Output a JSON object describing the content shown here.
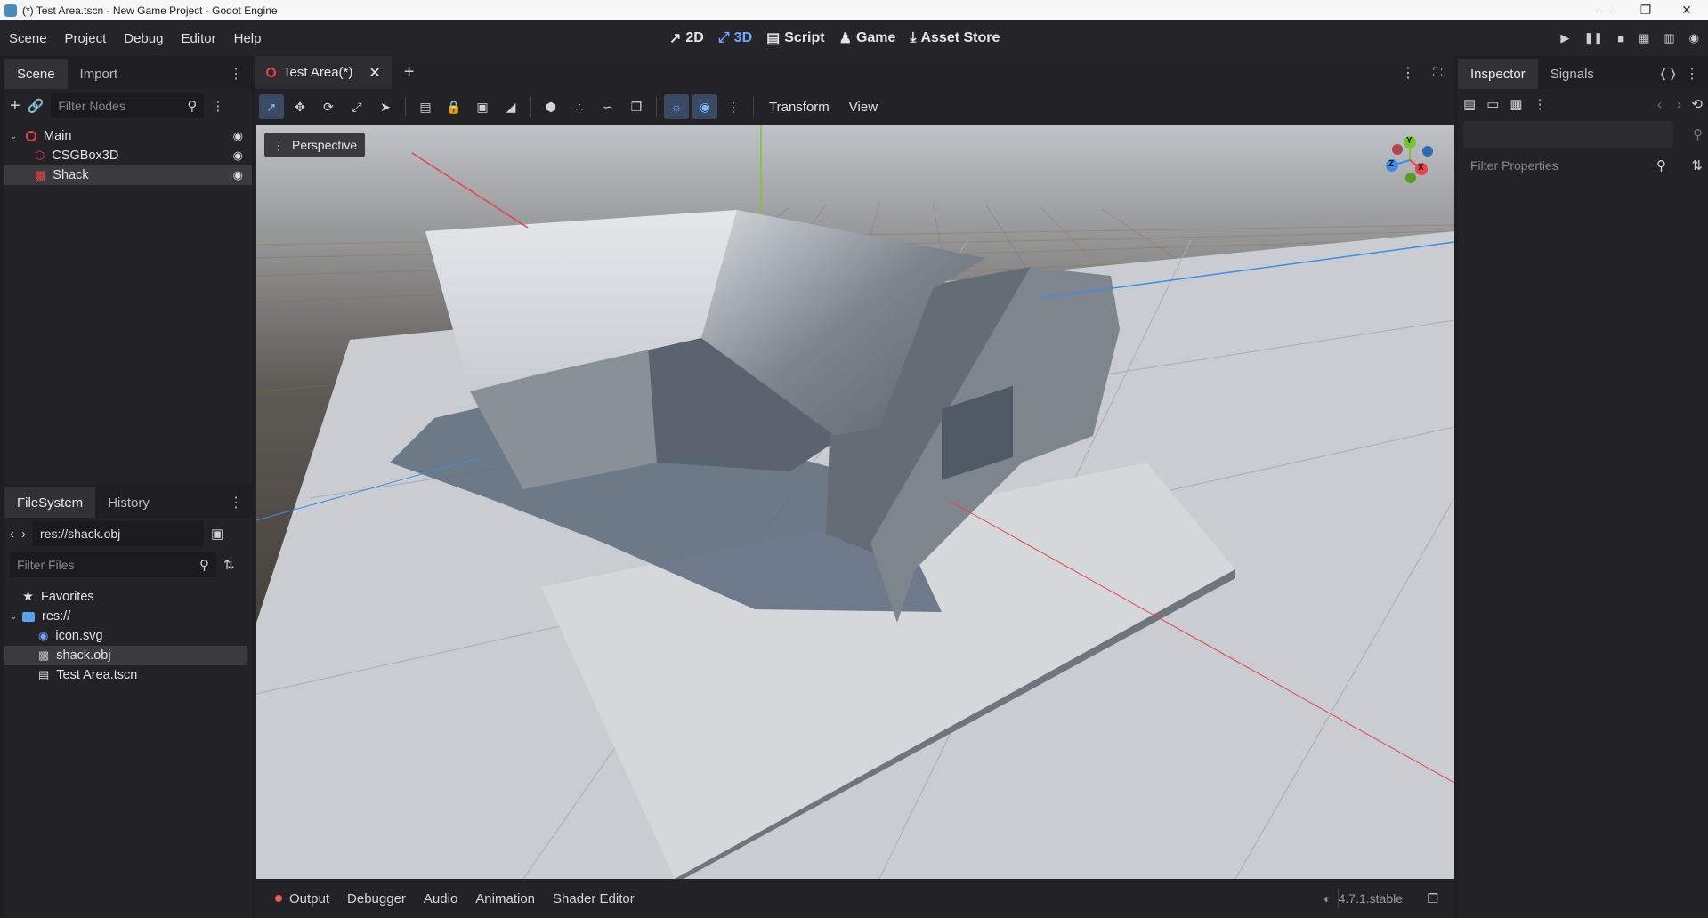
{
  "window": {
    "title": "(*) Test Area.tscn - New Game Project - Godot Engine",
    "controls": [
      "minimize",
      "restore",
      "close"
    ]
  },
  "menu": [
    "Scene",
    "Project",
    "Debug",
    "Editor",
    "Help"
  ],
  "main_tabs": [
    {
      "label": "2D",
      "icon": "2d-icon"
    },
    {
      "label": "3D",
      "icon": "3d-icon",
      "active": true
    },
    {
      "label": "Script",
      "icon": "script-icon"
    },
    {
      "label": "Game",
      "icon": "game-icon"
    },
    {
      "label": "Asset Store",
      "icon": "asset-store-icon"
    }
  ],
  "scene_panel": {
    "tabs": [
      "Scene",
      "Import"
    ],
    "filter_placeholder": "Filter Nodes",
    "nodes": [
      {
        "label": "Main",
        "icon": "node3d-icon",
        "level": 0
      },
      {
        "label": "CSGBox3D",
        "icon": "csgbox-icon",
        "level": 1
      },
      {
        "label": "Shack",
        "icon": "mesh-icon",
        "level": 1,
        "selected": true
      }
    ]
  },
  "filesystem_panel": {
    "tabs": [
      "FileSystem",
      "History"
    ],
    "path": "res://shack.obj",
    "filter_placeholder": "Filter Files",
    "items": [
      {
        "label": "Favorites",
        "icon": "star-icon",
        "level": 0
      },
      {
        "label": "res://",
        "icon": "folder-icon",
        "level": 0
      },
      {
        "label": "icon.svg",
        "icon": "svg-file-icon",
        "level": 1
      },
      {
        "label": "shack.obj",
        "icon": "obj-file-icon",
        "level": 1,
        "selected": true
      },
      {
        "label": "Test Area.tscn",
        "icon": "scene-file-icon",
        "level": 1
      }
    ]
  },
  "editor": {
    "scene_tab": "Test Area(*)",
    "toolbar_menus": [
      "Transform",
      "View"
    ],
    "viewport_label": "Perspective",
    "gizmo_axes": [
      "Y",
      "X",
      "Z"
    ]
  },
  "inspector_panel": {
    "tabs": [
      "Inspector",
      "Signals"
    ],
    "filter_placeholder": "Filter Properties"
  },
  "bottom_panel": {
    "tabs": [
      "Output",
      "Debugger",
      "Audio",
      "Animation",
      "Shader Editor"
    ],
    "version": "4.7.1.stable"
  },
  "colors": {
    "accent": "#6ea6ff",
    "axis_x": "#e8434b",
    "axis_y": "#79c72a",
    "axis_z": "#3a8ee6"
  }
}
